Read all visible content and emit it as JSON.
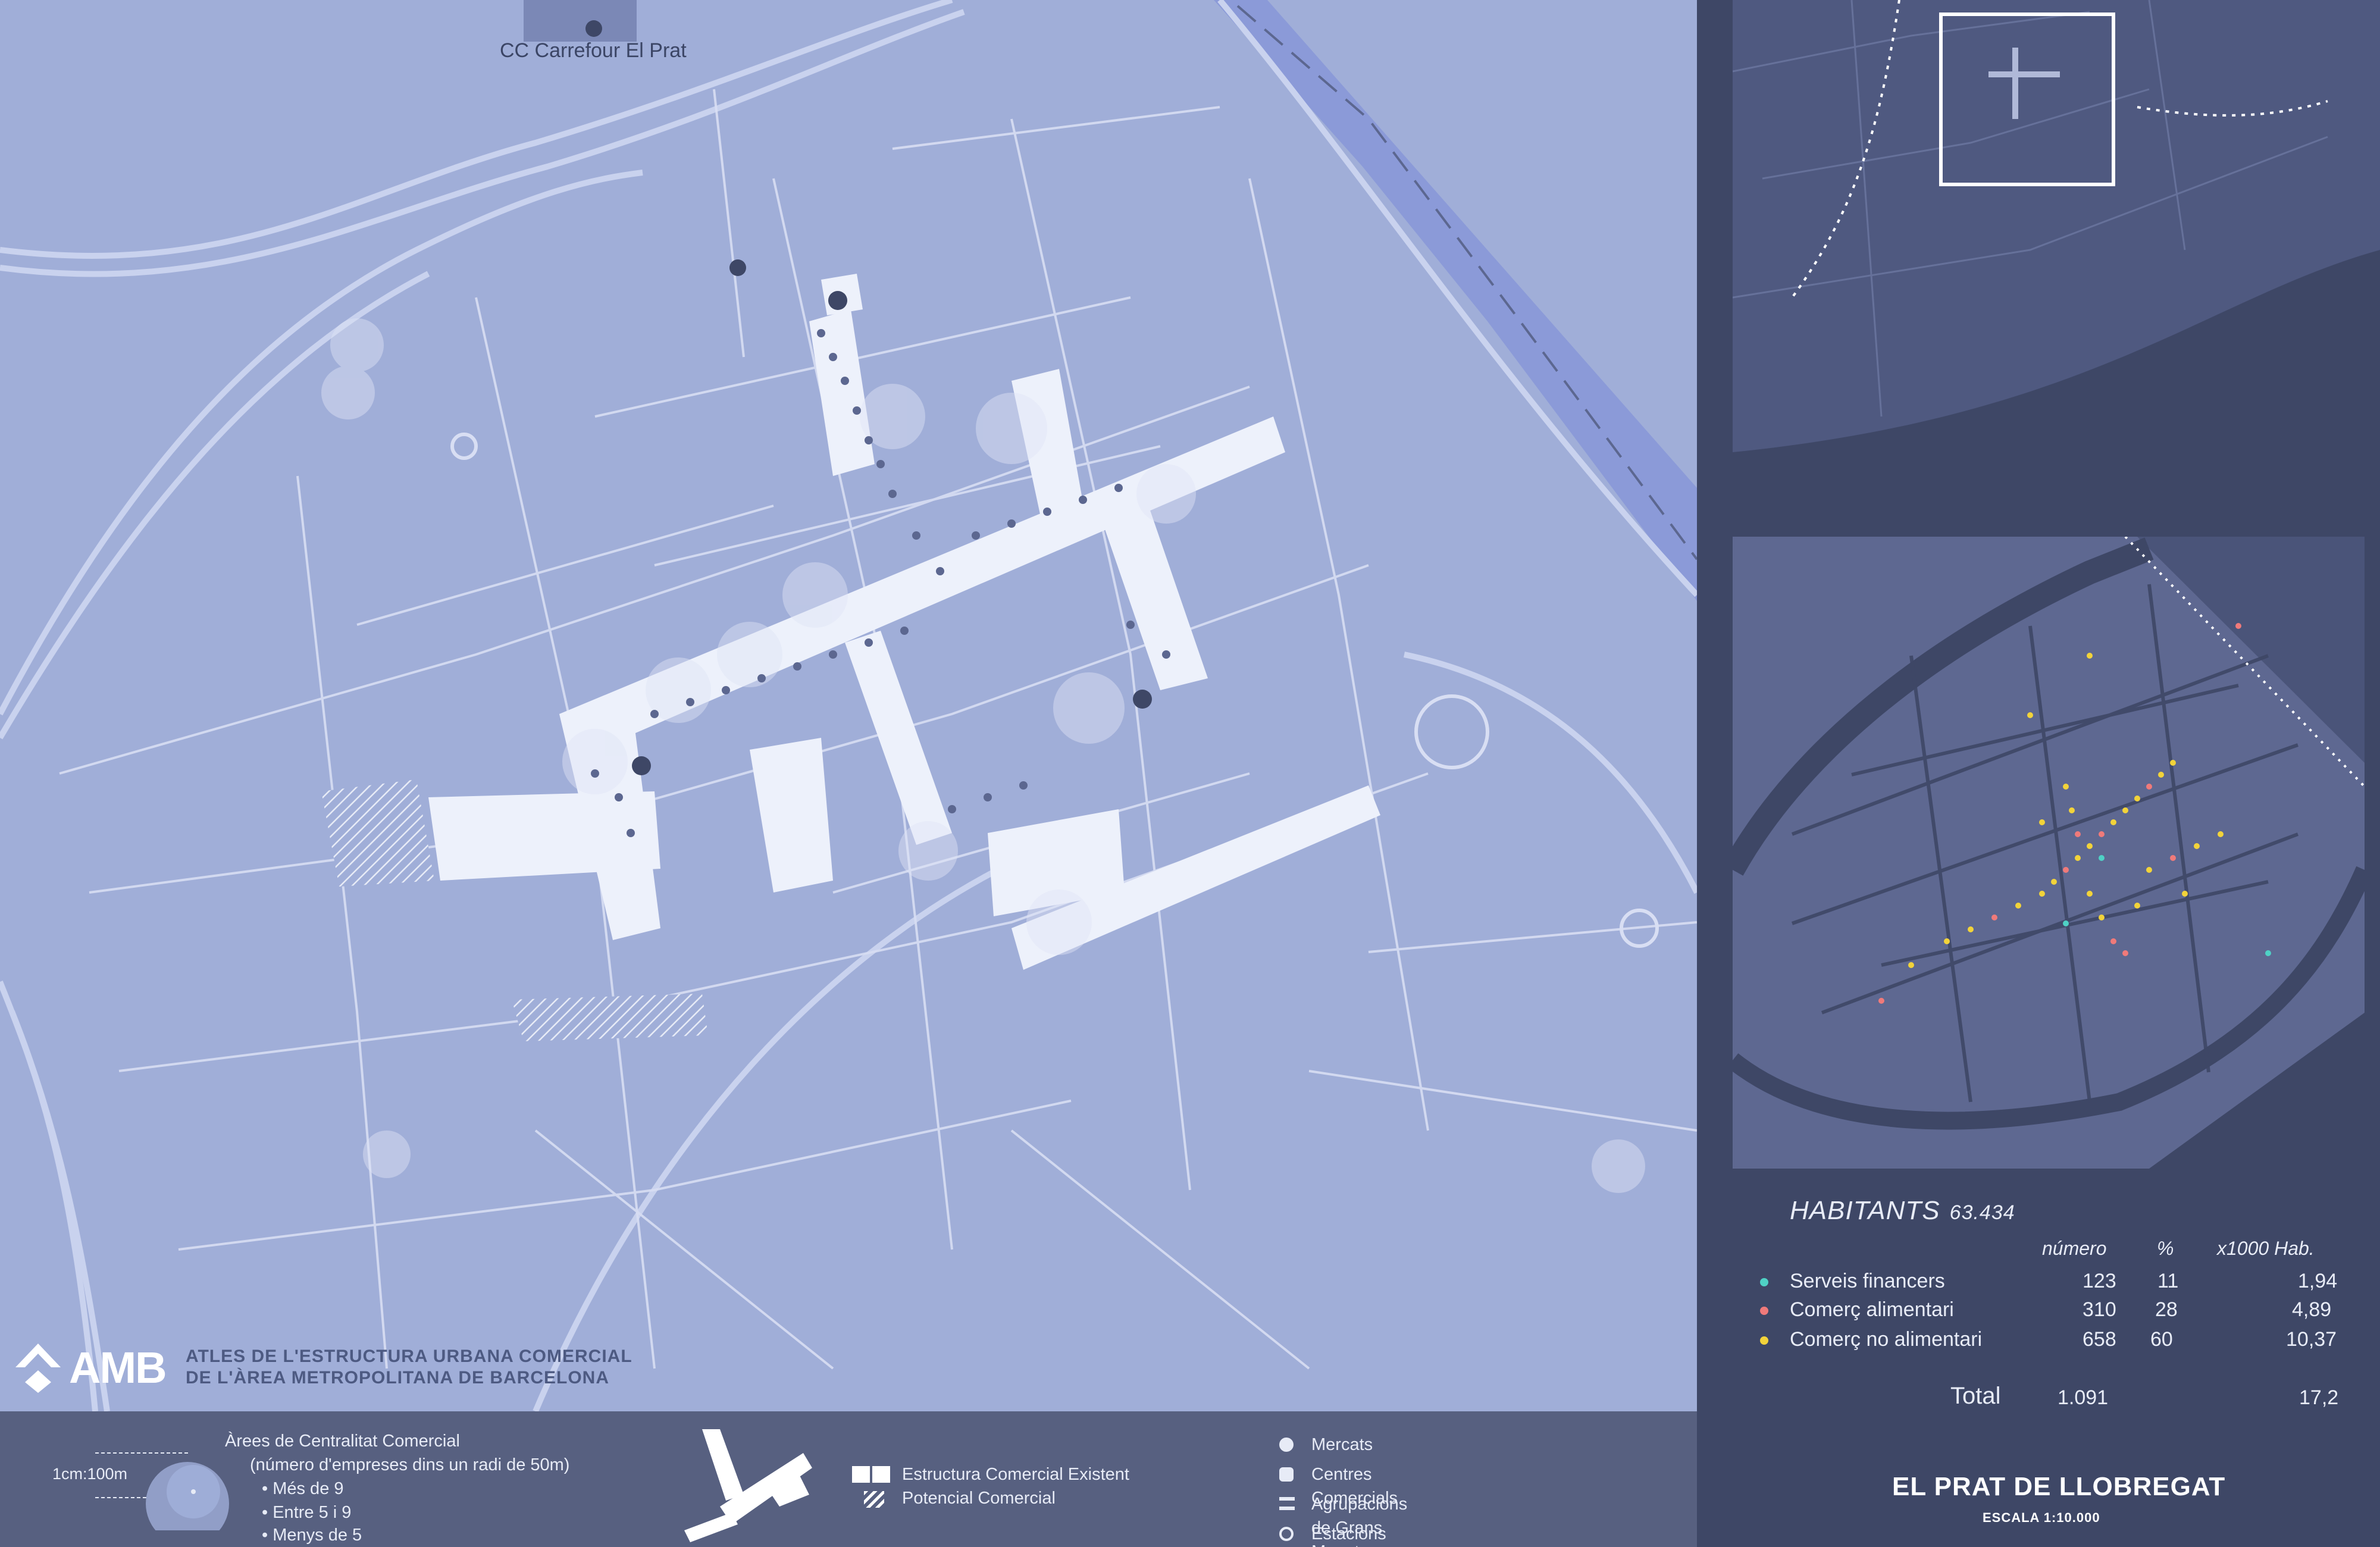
{
  "map": {
    "poi_label": "CC Carrefour El Prat"
  },
  "branding": {
    "logo_text": "AMB",
    "atlas_title_line1": "ATLES DE L'ESTRUCTURA URBANA COMERCIAL",
    "atlas_title_line2": "DE L'ÀREA METROPOLITANA DE BARCELONA"
  },
  "legend": {
    "centrality_title": "Àrees de Centralitat Comercial",
    "centrality_subtitle": "(número d'empreses dins un radi de 50m)",
    "scale_ref": "1cm:100m",
    "centrality_levels": [
      "Més de 9",
      "Entre 5 i 9",
      "Menys de 5"
    ],
    "structure_items": [
      "Estructura Comercial Existent",
      "Potencial Comercial"
    ],
    "poi_items": [
      {
        "icon": "market-icon",
        "label": "Mercats"
      },
      {
        "icon": "shopping-center-icon",
        "label": "Centres Comercials"
      },
      {
        "icon": "shopping-cart-icon",
        "label": "Agrupacions de Grans Magatzems"
      },
      {
        "icon": "train-station-icon",
        "label": "Estacions de Tren"
      }
    ]
  },
  "stats": {
    "title": "HABITANTS",
    "population": "63.434",
    "columns": [
      "número",
      "%",
      "x1000 Hab."
    ],
    "rows": [
      {
        "label": "Serveis financers",
        "color": "#4fd1c5",
        "numero": "123",
        "pct": "11",
        "per1000": "1,94"
      },
      {
        "label": "Comerç alimentari",
        "color": "#f07a7a",
        "numero": "310",
        "pct": "28",
        "per1000": "4,89"
      },
      {
        "label": "Comerç no alimentari",
        "color": "#f2d33a",
        "numero": "658",
        "pct": "60",
        "per1000": "10,37"
      }
    ],
    "total_label": "Total",
    "total_numero": "1.091",
    "total_per1000": "17,2"
  },
  "place": {
    "name": "EL PRAT DE LLOBREGAT",
    "scale": "ESCALA 1:10.000"
  },
  "colors": {
    "map_bg": "#a0aed8",
    "panel_bg": "#3e4766",
    "legend_bg": "#576080",
    "commercial_structure": "#edf1fb",
    "river": "#7f93d8"
  }
}
